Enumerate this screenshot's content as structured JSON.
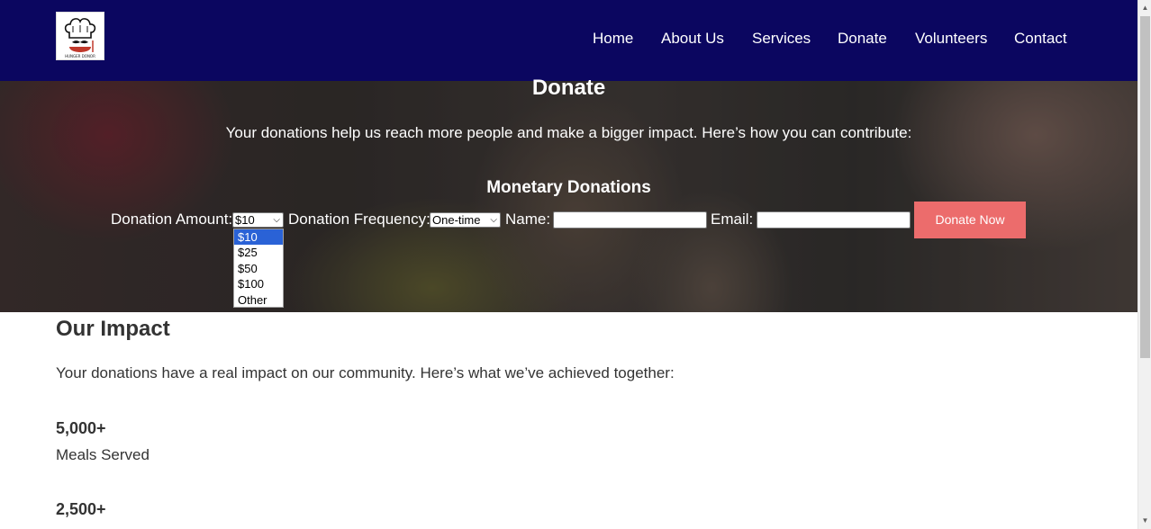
{
  "nav": {
    "items": [
      {
        "label": "Home"
      },
      {
        "label": "About Us"
      },
      {
        "label": "Services"
      },
      {
        "label": "Donate"
      },
      {
        "label": "Volunteers"
      },
      {
        "label": "Contact"
      }
    ]
  },
  "hero": {
    "title": "Donate",
    "intro": "Your donations help us reach more people and make a bigger impact. Here’s how you can contribute:",
    "section_title": "Monetary Donations"
  },
  "form": {
    "amount_label": "Donation Amount:",
    "amount_value": "$10",
    "frequency_label": "Donation Frequency:",
    "frequency_value": "One-time",
    "name_label": "Name:",
    "name_value": "",
    "email_label": "Email:",
    "email_value": "",
    "submit_label": "Donate Now",
    "amount_options": [
      "$10",
      "$25",
      "$50",
      "$100",
      "Other"
    ],
    "selected_option_index": 0
  },
  "impact": {
    "title": "Our Impact",
    "intro": "Your donations have a real impact on our community. Here’s what we’ve achieved together:",
    "stats": [
      {
        "value": "5,000+",
        "label": "Meals Served"
      },
      {
        "value": "2,500+",
        "label": ""
      }
    ]
  },
  "colors": {
    "header_bg": "#0b0660",
    "button_bg": "#ec6c6c",
    "selected_option_bg": "#2a62d6",
    "text_dark": "#333333"
  },
  "icons": {
    "logo": "chef-hat-logo-icon",
    "select_arrow": "chevron-down-icon"
  }
}
